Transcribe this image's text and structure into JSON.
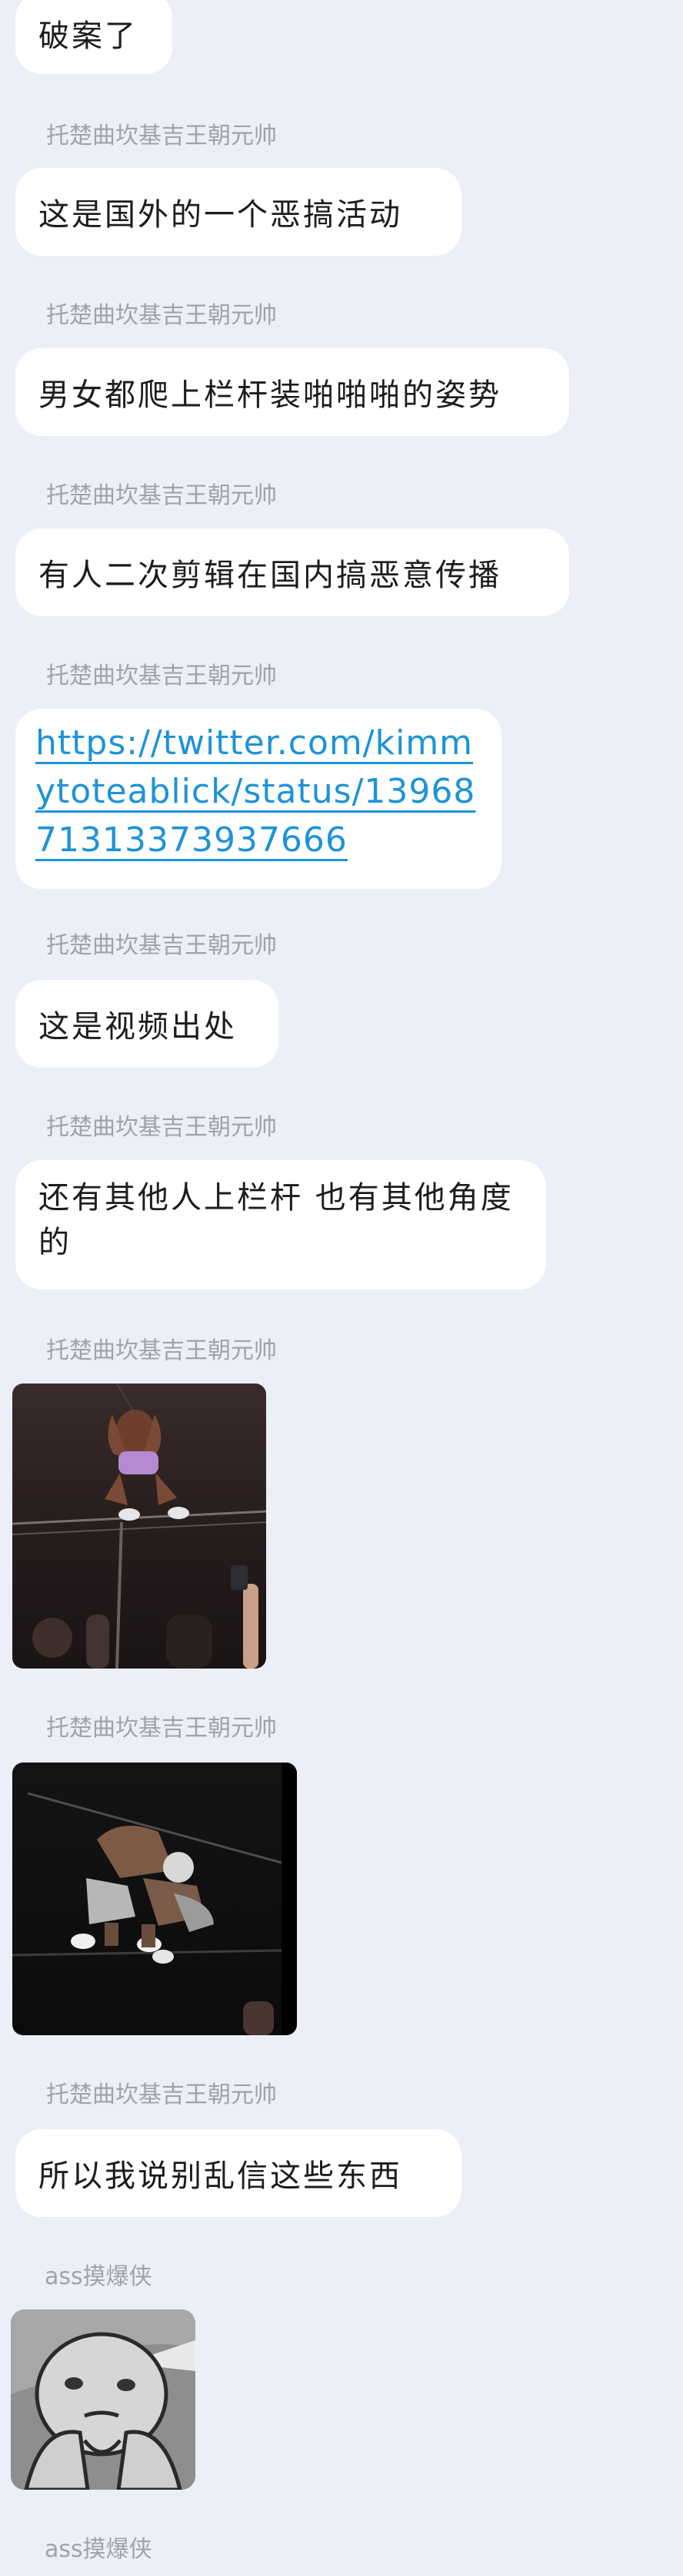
{
  "messages": [
    {
      "type": "text",
      "text": "破案了"
    },
    {
      "sender": "托楚曲坎基吉王朝元帅",
      "type": "text",
      "text": "这是国外的一个恶搞活动"
    },
    {
      "sender": "托楚曲坎基吉王朝元帅",
      "type": "text",
      "text": "男女都爬上栏杆装啪啪啪的姿势"
    },
    {
      "sender": "托楚曲坎基吉王朝元帅",
      "type": "text",
      "text": "有人二次剪辑在国内搞恶意传播"
    },
    {
      "sender": "托楚曲坎基吉王朝元帅",
      "type": "link",
      "text": "https://twitter.com/kimmytoteablick/status/1396871313373937666"
    },
    {
      "sender": "托楚曲坎基吉王朝元帅",
      "type": "text",
      "text": "这是视频出处"
    },
    {
      "sender": "托楚曲坎基吉王朝元帅",
      "type": "text",
      "text": "还有其他人上栏杆 也有其他角度的"
    },
    {
      "sender": "托楚曲坎基吉王朝元帅",
      "type": "image",
      "image": "photo-person-on-railing"
    },
    {
      "sender": "托楚曲坎基吉王朝元帅",
      "type": "image",
      "image": "photo-two-people-on-railing"
    },
    {
      "sender": "托楚曲坎基吉王朝元帅",
      "type": "text",
      "text": "所以我说别乱信这些东西"
    },
    {
      "sender": "ass摸爆侠",
      "type": "image",
      "image": "meme-sticker-face"
    },
    {
      "sender": "ass摸爆侠"
    }
  ]
}
